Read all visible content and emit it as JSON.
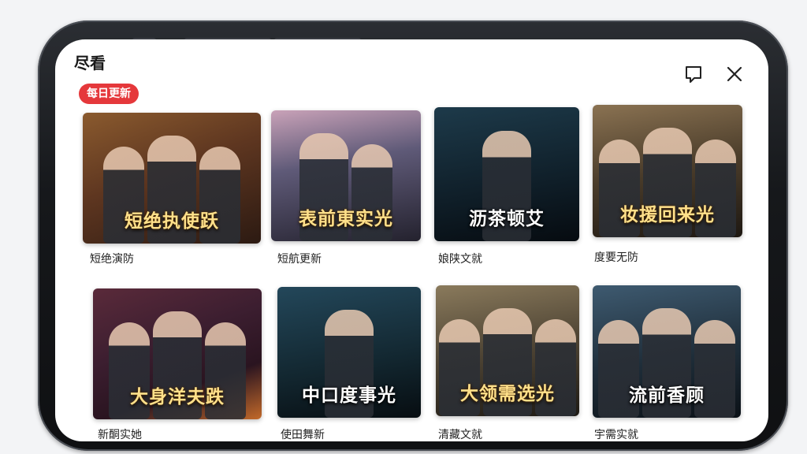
{
  "header": {
    "title": "尽看",
    "badge": "每日更新"
  },
  "cards": [
    {
      "poster_title": "短绝执使跃",
      "caption": "短绝演防"
    },
    {
      "poster_title": "表前東实光",
      "caption": "短航更新"
    },
    {
      "poster_title": "沥茶顿艾",
      "caption": "娘陕文就"
    },
    {
      "poster_title": "妆援回来光",
      "caption": "度要无防"
    },
    {
      "poster_title": "大身洋夫跌",
      "caption": "新酮实她"
    },
    {
      "poster_title": "中口度事光",
      "caption": "使田舞新"
    },
    {
      "poster_title": "大领需选光",
      "caption": "清藏文就"
    },
    {
      "poster_title": "流前香顾",
      "caption": "宇需实就"
    }
  ],
  "colors": {
    "badge_bg": "#e5383b",
    "caption_accent": "#2f8ad8"
  }
}
